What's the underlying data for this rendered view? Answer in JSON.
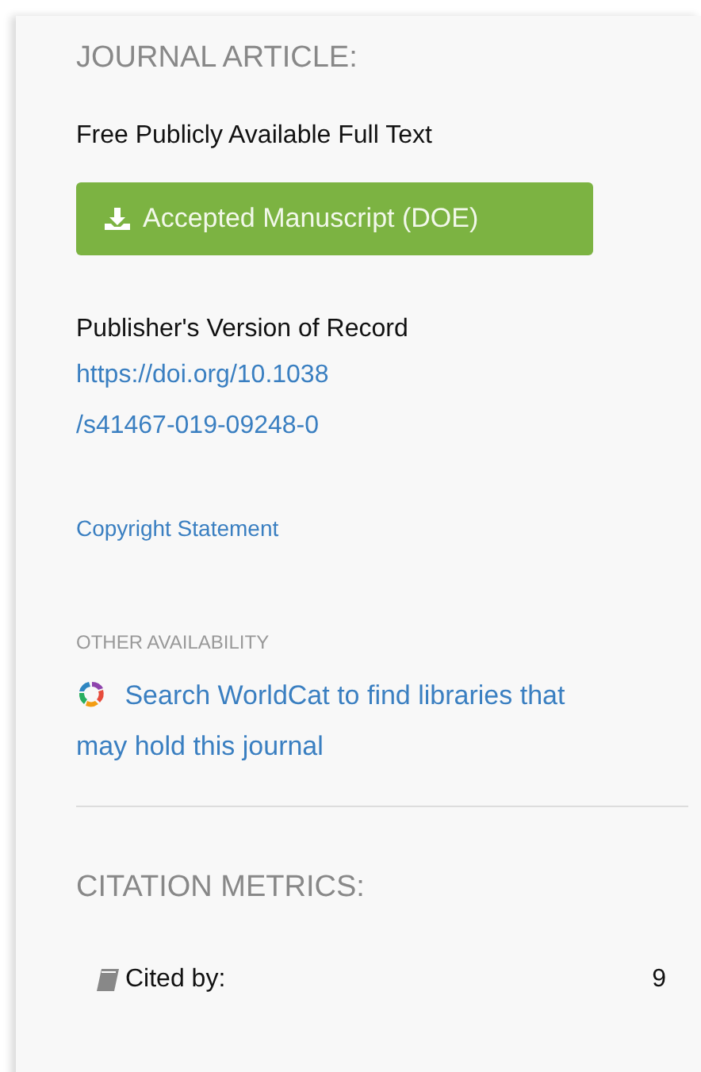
{
  "journal_article": {
    "heading": "JOURNAL ARTICLE:",
    "full_text_label": "Free Publicly Available Full Text",
    "download_button": "Accepted Manuscript (DOE)",
    "publisher_label": "Publisher's Version of Record",
    "doi_link": [
      "https://doi.org/10.1038",
      "/s41467-019-09248-0"
    ],
    "copyright_link": "Copyright Statement"
  },
  "other_availability": {
    "heading": "OTHER AVAILABILITY",
    "worldcat_link": [
      "Search WorldCat to find libraries that",
      "may hold this journal"
    ]
  },
  "citation_metrics": {
    "heading": "CITATION METRICS:",
    "rows": [
      {
        "label": "Cited by:",
        "value": "9"
      }
    ]
  }
}
